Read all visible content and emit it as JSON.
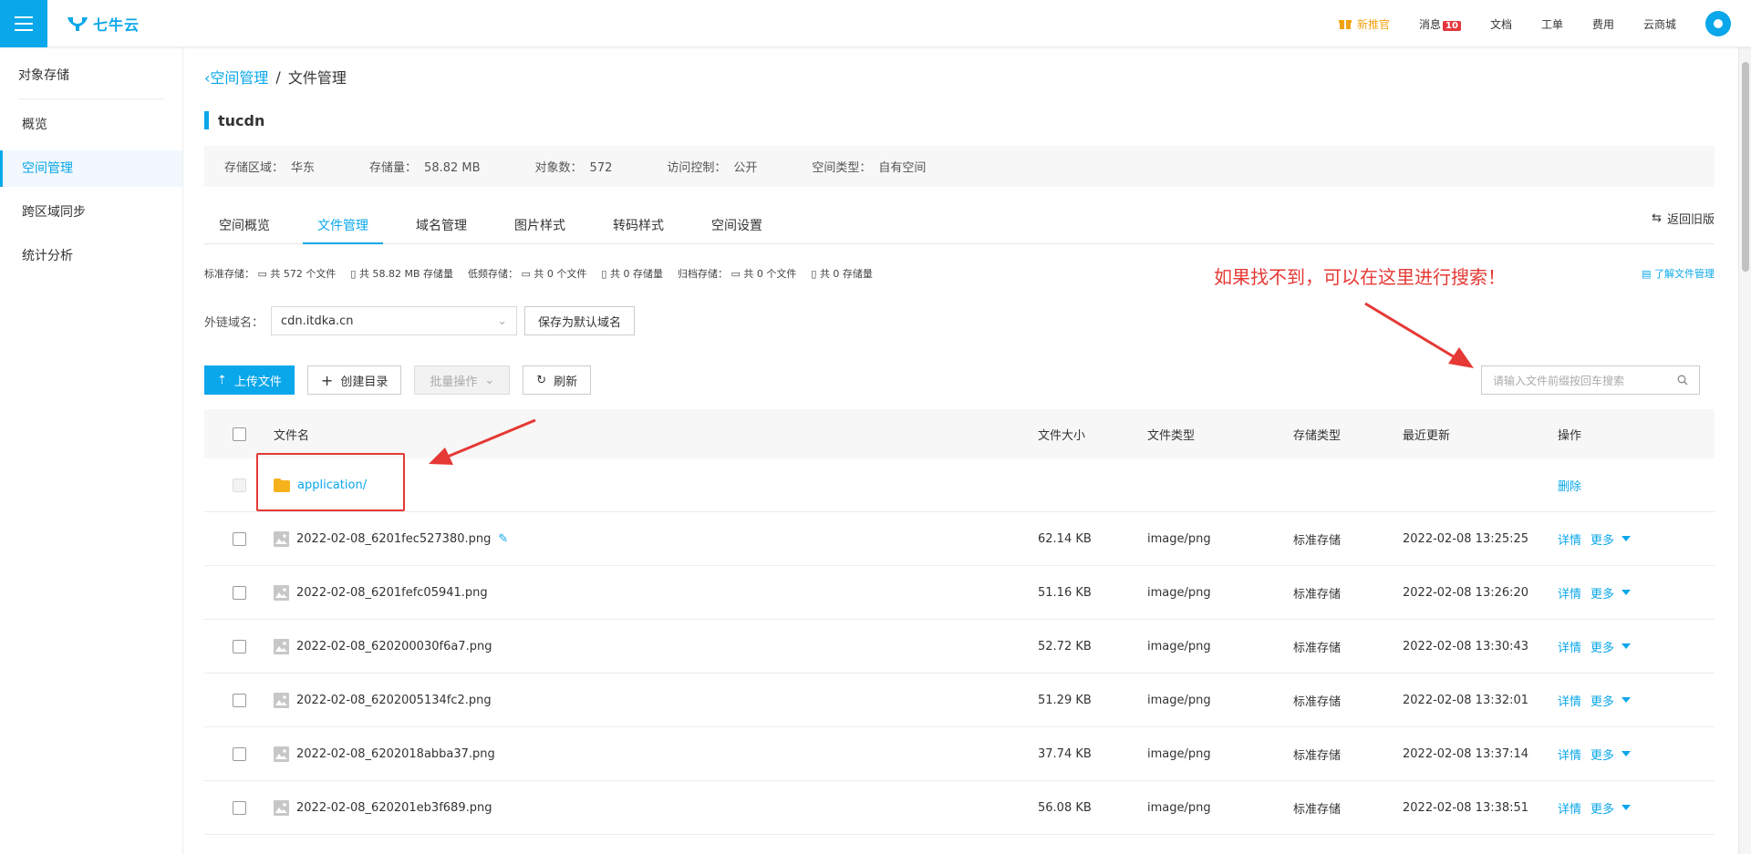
{
  "header": {
    "logo_text": "七牛云",
    "nav": [
      {
        "label": "新推官",
        "icon": "gift-icon"
      },
      {
        "label": "消息",
        "badge": "10"
      },
      {
        "label": "文档"
      },
      {
        "label": "工单"
      },
      {
        "label": "费用"
      },
      {
        "label": "云商城"
      }
    ]
  },
  "sidebar": {
    "title": "对象存储",
    "items": [
      {
        "label": "概览"
      },
      {
        "label": "空间管理",
        "active": true
      },
      {
        "label": "跨区域同步"
      },
      {
        "label": "统计分析"
      }
    ]
  },
  "breadcrumb": {
    "back": "空间管理",
    "sep": "/",
    "current": "文件管理"
  },
  "bucket": {
    "name": "tucdn",
    "info": [
      {
        "label": "存储区域：",
        "value": "华东"
      },
      {
        "label": "存储量：",
        "value": "58.82 MB"
      },
      {
        "label": "对象数：",
        "value": "572"
      },
      {
        "label": "访问控制：",
        "value": "公开"
      },
      {
        "label": "空间类型：",
        "value": "自有空间"
      }
    ]
  },
  "tabs": [
    "空间概览",
    "文件管理",
    "域名管理",
    "图片样式",
    "转码样式",
    "空间设置"
  ],
  "active_tab": "文件管理",
  "back_old": "返回旧版",
  "summary": [
    "标准存储：",
    "共 572 个文件",
    "共 58.82 MB 存储量",
    "低频存储：",
    "共 0 个文件",
    "共 0 存储量",
    "归档存储：",
    "共 0 个文件",
    "共 0 存储量"
  ],
  "learn_link": "了解文件管理",
  "annotation": "如果找不到，可以在这里进行搜索！",
  "domain": {
    "label": "外链域名：",
    "value": "cdn.itdka.cn",
    "save_button": "保存为默认域名"
  },
  "toolbar": {
    "upload": "上传文件",
    "mkdir": "创建目录",
    "batch": "批量操作",
    "refresh": "刷新"
  },
  "search": {
    "placeholder": "请输入文件前缀按回车搜索"
  },
  "table": {
    "headers": [
      "文件名",
      "文件大小",
      "文件类型",
      "存储类型",
      "最近更新",
      "操作"
    ],
    "folder": {
      "name": "application/",
      "op": "删除"
    },
    "rows": [
      {
        "name": "2022-02-08_6201fec527380.png",
        "size": "62.14 KB",
        "type": "image/png",
        "storage": "标准存储",
        "updated": "2022-02-08 13:25:25",
        "edit": true
      },
      {
        "name": "2022-02-08_6201fefc05941.png",
        "size": "51.16 KB",
        "type": "image/png",
        "storage": "标准存储",
        "updated": "2022-02-08 13:26:20"
      },
      {
        "name": "2022-02-08_620200030f6a7.png",
        "size": "52.72 KB",
        "type": "image/png",
        "storage": "标准存储",
        "updated": "2022-02-08 13:30:43"
      },
      {
        "name": "2022-02-08_6202005134fc2.png",
        "size": "51.29 KB",
        "type": "image/png",
        "storage": "标准存储",
        "updated": "2022-02-08 13:32:01"
      },
      {
        "name": "2022-02-08_6202018abba37.png",
        "size": "37.74 KB",
        "type": "image/png",
        "storage": "标准存储",
        "updated": "2022-02-08 13:37:14"
      },
      {
        "name": "2022-02-08_620201eb3f689.png",
        "size": "56.08 KB",
        "type": "image/png",
        "storage": "标准存储",
        "updated": "2022-02-08 13:38:51"
      }
    ],
    "op_detail": "详情",
    "op_more": "更多"
  },
  "colors": {
    "accent": "#0aa7ea",
    "annotation": "#e53935",
    "promo": "#f2a314"
  }
}
